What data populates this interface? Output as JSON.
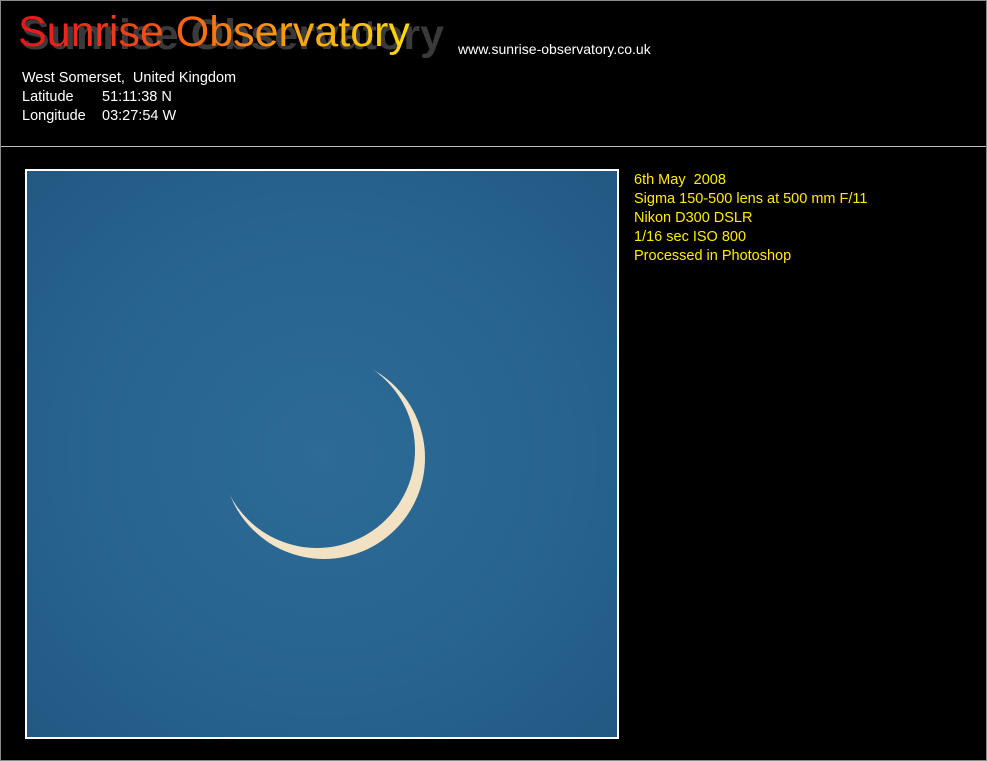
{
  "header": {
    "title": "Sunrise Observatory",
    "url": "www.sunrise-observatory.co.uk"
  },
  "location": {
    "place": "West Somerset,  United Kingdom",
    "latitude_label": "Latitude",
    "latitude_value": "51:11:38 N",
    "longitude_label": "Longitude",
    "longitude_value": "03:27:54 W"
  },
  "image": {
    "subject": "crescent-moon",
    "sky_color": "#27628d",
    "crescent_color": "#f3e7cf"
  },
  "details": {
    "lines": [
      "6th May  2008",
      "Sigma 150-500 lens at 500 mm F/11",
      "Nikon D300 DSLR",
      "1/16 sec ISO 800",
      "Processed in Photoshop"
    ]
  },
  "colors": {
    "background": "#000000",
    "title_gradient_start": "#e8141c",
    "title_gradient_end": "#fbd910",
    "detail_text": "#ffeb00",
    "body_text": "#ffffff"
  }
}
